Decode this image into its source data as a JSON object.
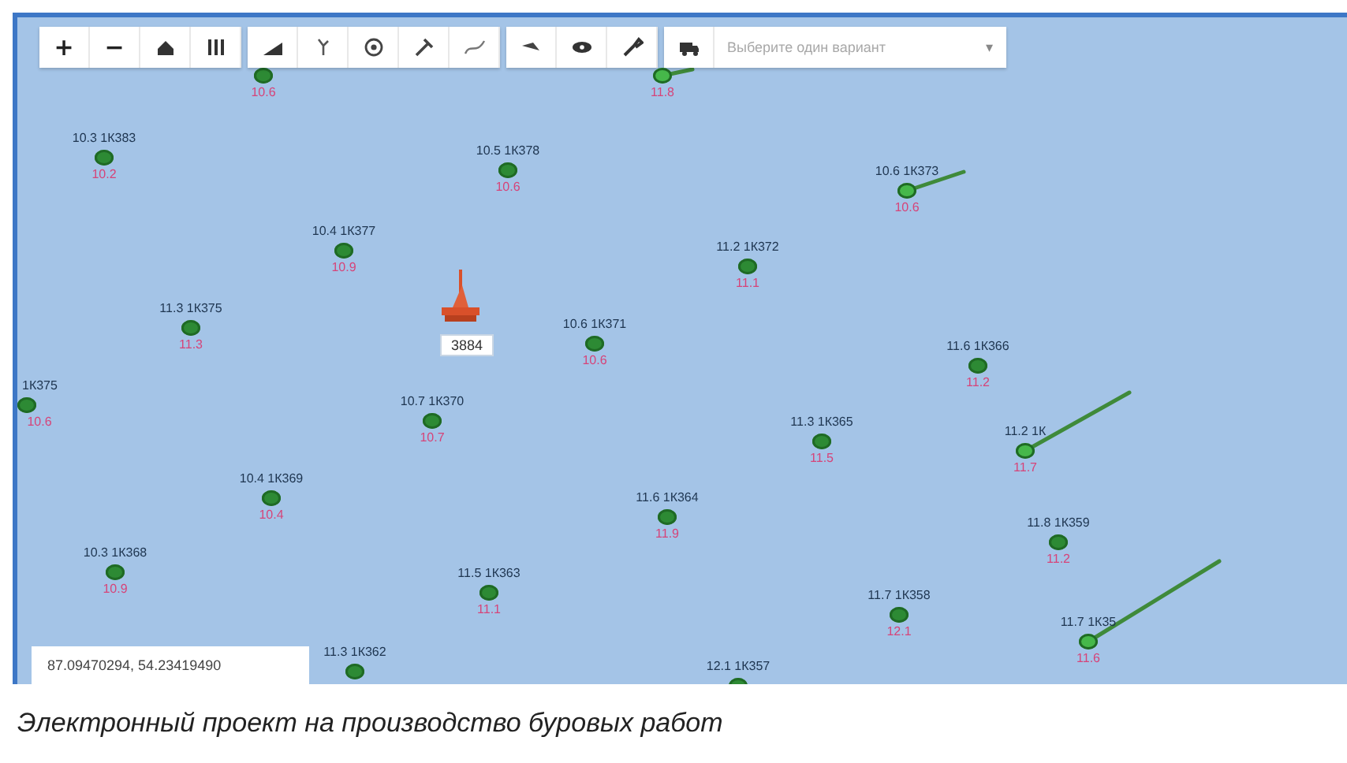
{
  "toolbar": {
    "zoom_in": "+",
    "zoom_out": "−",
    "select": {
      "placeholder": "Выберите один вариант",
      "arrow": "▾"
    }
  },
  "wells": [
    {
      "kind": "vertical",
      "value": "10.6"
    },
    {
      "kind": "directional",
      "value": "11.8"
    },
    {
      "kind": "vertical",
      "label": "10.3 1К383",
      "value": "10.2"
    },
    {
      "kind": "vertical",
      "label": "10.5 1К378",
      "value": "10.6"
    },
    {
      "kind": "vertical",
      "label": "10.4 1К377",
      "value": "10.9"
    },
    {
      "kind": "directional",
      "label": "10.6 1К373",
      "value": "10.6"
    },
    {
      "kind": "vertical",
      "label": "11.2 1К372",
      "value": "11.1"
    },
    {
      "kind": "vertical",
      "label": "11.3 1К375",
      "value": "11.3"
    },
    {
      "kind": "vertical",
      "label": "10.6 1К371",
      "value": "10.6"
    },
    {
      "kind": "vertical",
      "label": "1К375",
      "value": "10.6"
    },
    {
      "kind": "vertical",
      "label": "10.7 1К370",
      "value": "10.7"
    },
    {
      "kind": "vertical",
      "label": "11.6 1К366",
      "value": "11.2"
    },
    {
      "kind": "vertical",
      "label": "11.3 1К365",
      "value": "11.5"
    },
    {
      "kind": "directional",
      "label": "11.2 1К",
      "value": "11.7"
    },
    {
      "kind": "vertical",
      "label": "10.4 1К369",
      "value": "10.4"
    },
    {
      "kind": "vertical",
      "label": "11.6 1К364",
      "value": "11.9"
    },
    {
      "kind": "vertical",
      "label": "11.8 1К359",
      "value": "11.2"
    },
    {
      "kind": "vertical",
      "label": "10.3 1К368",
      "value": "10.9"
    },
    {
      "kind": "vertical",
      "label": "11.5 1К363",
      "value": "11.1"
    },
    {
      "kind": "vertical",
      "label": "11.7 1К358",
      "value": "12.1"
    },
    {
      "kind": "directional",
      "label": "11.7 1К35",
      "value": "11.6"
    },
    {
      "kind": "vertical",
      "label": "11.3 1К362"
    },
    {
      "kind": "vertical",
      "label": "12.1 1К357"
    }
  ],
  "rig": {
    "label": "3884"
  },
  "coordinates": "87.09470294, 54.23419490",
  "caption": "Электронный проект на производство буровых работ"
}
